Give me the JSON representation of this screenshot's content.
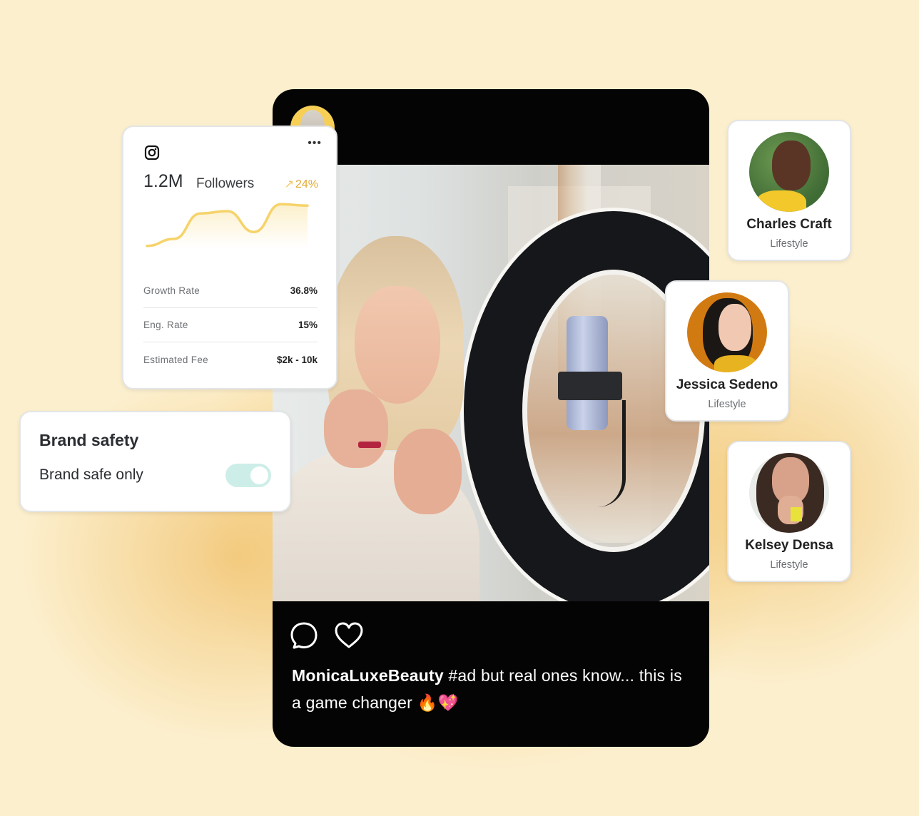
{
  "post": {
    "username": "MonicaLuxeBeauty",
    "caption": " #ad but real ones know... this is a game changer 🔥💖",
    "actions": [
      {
        "name": "comment",
        "icon": "comment-icon"
      },
      {
        "name": "like",
        "icon": "heart-icon"
      }
    ]
  },
  "stats_card": {
    "platform_icon": "instagram-icon",
    "more_label": "•••",
    "followers_count": "1.2M",
    "followers_label": "Followers",
    "growth_arrow": "↗",
    "growth_percent": "24%",
    "rows": [
      {
        "label": "Growth Rate",
        "value": "36.8%"
      },
      {
        "label": "Eng. Rate",
        "value": "15%"
      },
      {
        "label": "Estimated Fee",
        "value": "$2k - 10k"
      }
    ],
    "sparkline_trend": [
      0.05,
      0.2,
      0.75,
      0.8,
      0.35,
      0.95,
      0.92
    ]
  },
  "brand_safety": {
    "title": "Brand safety",
    "toggle_label": "Brand safe only",
    "toggle_on": true
  },
  "influencers": [
    {
      "name": "Charles Craft",
      "category": "Lifestyle"
    },
    {
      "name": "Jessica Sedeno",
      "category": "Lifestyle"
    },
    {
      "name": "Kelsey Densa",
      "category": "Lifestyle"
    }
  ],
  "colors": {
    "background": "#fcefcd",
    "accent_yellow": "#f6d36a",
    "growth_text": "#e2a836",
    "toggle_track": "#cdeee8",
    "post_bg": "#040404"
  }
}
